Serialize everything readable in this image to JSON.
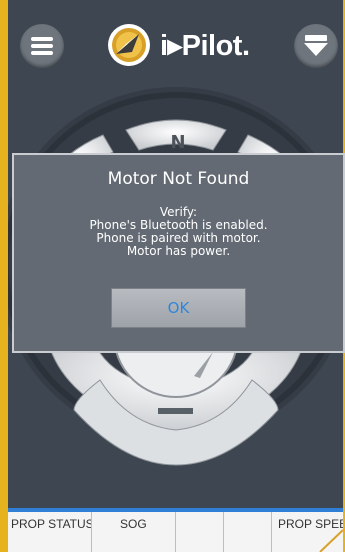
{
  "header": {
    "menu_icon": "hamburger-menu-icon",
    "logo_text": "i▸Pilot.",
    "dropdown_icon": "arrow-down-icon"
  },
  "compass": {
    "north_label": "N"
  },
  "statusbar": {
    "cells": [
      "PROP STATUS",
      "SOG",
      "",
      "",
      "PROP SPEED"
    ]
  },
  "dialog": {
    "title": "Motor Not Found",
    "message_lines": [
      "Verify:",
      "Phone's Bluetooth is enabled.",
      "Phone is paired with motor.",
      "Motor has power."
    ],
    "ok_label": "OK"
  },
  "colors": {
    "frame": "#e6b21e",
    "app_background": "#3e4651",
    "dialog_background": "#636a74",
    "ok_text": "#2f86db",
    "statusbar_accent": "#2f7fd6"
  }
}
